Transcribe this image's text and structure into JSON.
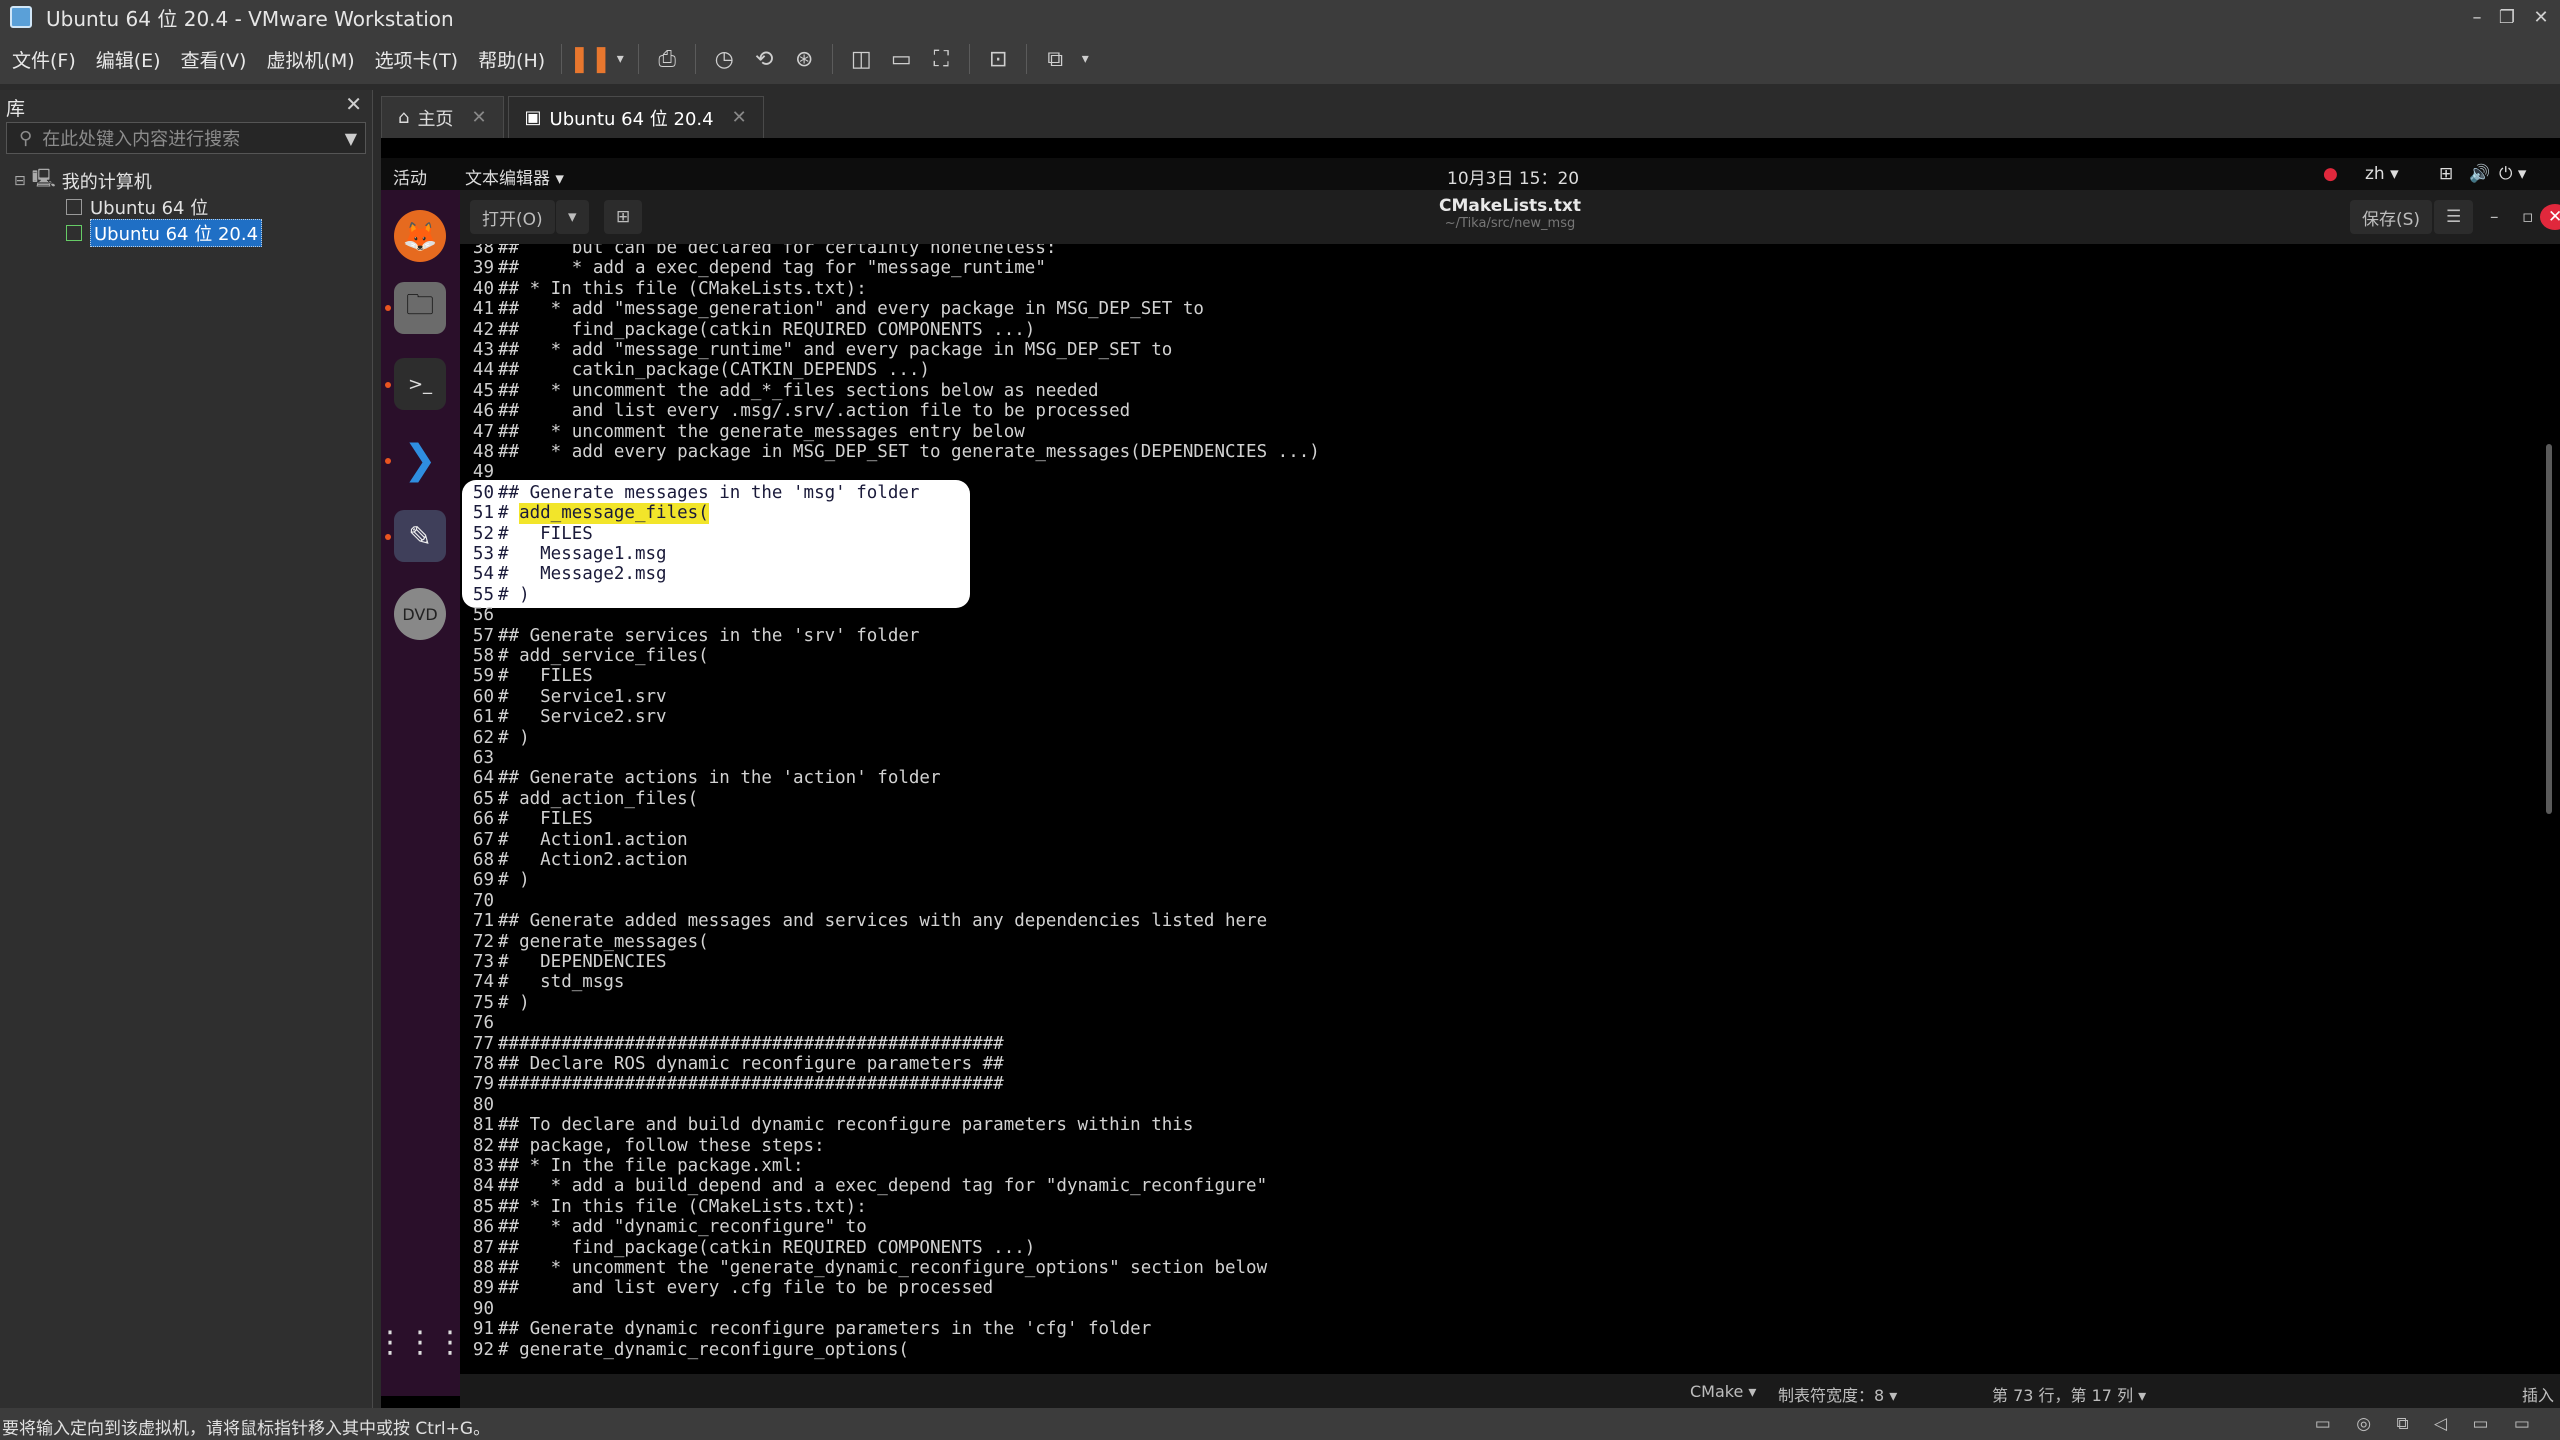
{
  "window": {
    "title": "Ubuntu 64 位 20.4 - VMware Workstation",
    "min": "–",
    "max": "❐",
    "close": "✕"
  },
  "menu": [
    "文件(F)",
    "编辑(E)",
    "查看(V)",
    "虚拟机(M)",
    "选项卡(T)",
    "帮助(H)"
  ],
  "library": {
    "title": "库",
    "search_placeholder": "在此处键入内容进行搜索",
    "root": "我的计算机",
    "vms": [
      "Ubuntu 64 位",
      "Ubuntu 64 位 20.4"
    ]
  },
  "tabs": [
    {
      "label": "主页"
    },
    {
      "label": "Ubuntu 64 位 20.4"
    }
  ],
  "guest": {
    "activities": "活动",
    "app_menu": "文本编辑器 ▾",
    "clock": "10月3日 15：20",
    "input": "zh ▾",
    "open_label": "打开(O)",
    "save_label": "保存(S)",
    "file_title": "CMakeLists.txt",
    "file_path": "~/Tika/src/new_msg",
    "status_lang": "CMake ▾",
    "status_tab": "制表符宽度：8 ▾",
    "status_pos": "第 73 行，第 17 列 ▾",
    "status_mode": "插入"
  },
  "code_lines": [
    {
      "n": "38",
      "t": "##     but can be declared for certainty nonetheless:"
    },
    {
      "n": "39",
      "t": "##     * add a exec_depend tag for \"message_runtime\""
    },
    {
      "n": "40",
      "t": "## * In this file (CMakeLists.txt):"
    },
    {
      "n": "41",
      "t": "##   * add \"message_generation\" and every package in MSG_DEP_SET to"
    },
    {
      "n": "42",
      "t": "##     find_package(catkin REQUIRED COMPONENTS ...)"
    },
    {
      "n": "43",
      "t": "##   * add \"message_runtime\" and every package in MSG_DEP_SET to"
    },
    {
      "n": "44",
      "t": "##     catkin_package(CATKIN_DEPENDS ...)"
    },
    {
      "n": "45",
      "t": "##   * uncomment the add_*_files sections below as needed"
    },
    {
      "n": "46",
      "t": "##     and list every .msg/.srv/.action file to be processed"
    },
    {
      "n": "47",
      "t": "##   * uncomment the generate_messages entry below"
    },
    {
      "n": "48",
      "t": "##   * add every package in MSG_DEP_SET to generate_messages(DEPENDENCIES ...)"
    },
    {
      "n": "49",
      "t": ""
    },
    {
      "n": "50",
      "t": "## Generate messages in the 'msg' folder"
    },
    {
      "n": "51",
      "t": "# ",
      "hl": "add_message_files("
    },
    {
      "n": "52",
      "t": "#   FILES"
    },
    {
      "n": "53",
      "t": "#   Message1.msg"
    },
    {
      "n": "54",
      "t": "#   Message2.msg"
    },
    {
      "n": "55",
      "t": "# )"
    },
    {
      "n": "56",
      "t": ""
    },
    {
      "n": "57",
      "t": "## Generate services in the 'srv' folder"
    },
    {
      "n": "58",
      "t": "# add_service_files("
    },
    {
      "n": "59",
      "t": "#   FILES"
    },
    {
      "n": "60",
      "t": "#   Service1.srv"
    },
    {
      "n": "61",
      "t": "#   Service2.srv"
    },
    {
      "n": "62",
      "t": "# )"
    },
    {
      "n": "63",
      "t": ""
    },
    {
      "n": "64",
      "t": "## Generate actions in the 'action' folder"
    },
    {
      "n": "65",
      "t": "# add_action_files("
    },
    {
      "n": "66",
      "t": "#   FILES"
    },
    {
      "n": "67",
      "t": "#   Action1.action"
    },
    {
      "n": "68",
      "t": "#   Action2.action"
    },
    {
      "n": "69",
      "t": "# )"
    },
    {
      "n": "70",
      "t": ""
    },
    {
      "n": "71",
      "t": "## Generate added messages and services with any dependencies listed here"
    },
    {
      "n": "72",
      "t": "# generate_messages("
    },
    {
      "n": "73",
      "t": "#   DEPENDENCIES"
    },
    {
      "n": "74",
      "t": "#   std_msgs"
    },
    {
      "n": "75",
      "t": "# )"
    },
    {
      "n": "76",
      "t": ""
    },
    {
      "n": "77",
      "t": "################################################"
    },
    {
      "n": "78",
      "t": "## Declare ROS dynamic reconfigure parameters ##"
    },
    {
      "n": "79",
      "t": "################################################"
    },
    {
      "n": "80",
      "t": ""
    },
    {
      "n": "81",
      "t": "## To declare and build dynamic reconfigure parameters within this"
    },
    {
      "n": "82",
      "t": "## package, follow these steps:"
    },
    {
      "n": "83",
      "t": "## * In the file package.xml:"
    },
    {
      "n": "84",
      "t": "##   * add a build_depend and a exec_depend tag for \"dynamic_reconfigure\""
    },
    {
      "n": "85",
      "t": "## * In this file (CMakeLists.txt):"
    },
    {
      "n": "86",
      "t": "##   * add \"dynamic_reconfigure\" to"
    },
    {
      "n": "87",
      "t": "##     find_package(catkin REQUIRED COMPONENTS ...)"
    },
    {
      "n": "88",
      "t": "##   * uncomment the \"generate_dynamic_reconfigure_options\" section below"
    },
    {
      "n": "89",
      "t": "##     and list every .cfg file to be processed"
    },
    {
      "n": "90",
      "t": ""
    },
    {
      "n": "91",
      "t": "## Generate dynamic reconfigure parameters in the 'cfg' folder"
    },
    {
      "n": "92",
      "t": "# generate_dynamic_reconfigure_options("
    }
  ],
  "vm_status": "要将输入定向到该虚拟机，请将鼠标指针移入其中或按 Ctrl+G。",
  "status_icons": "▭ ◎ ⧉ ◁ ▭ ▭",
  "accent": "#e95420"
}
